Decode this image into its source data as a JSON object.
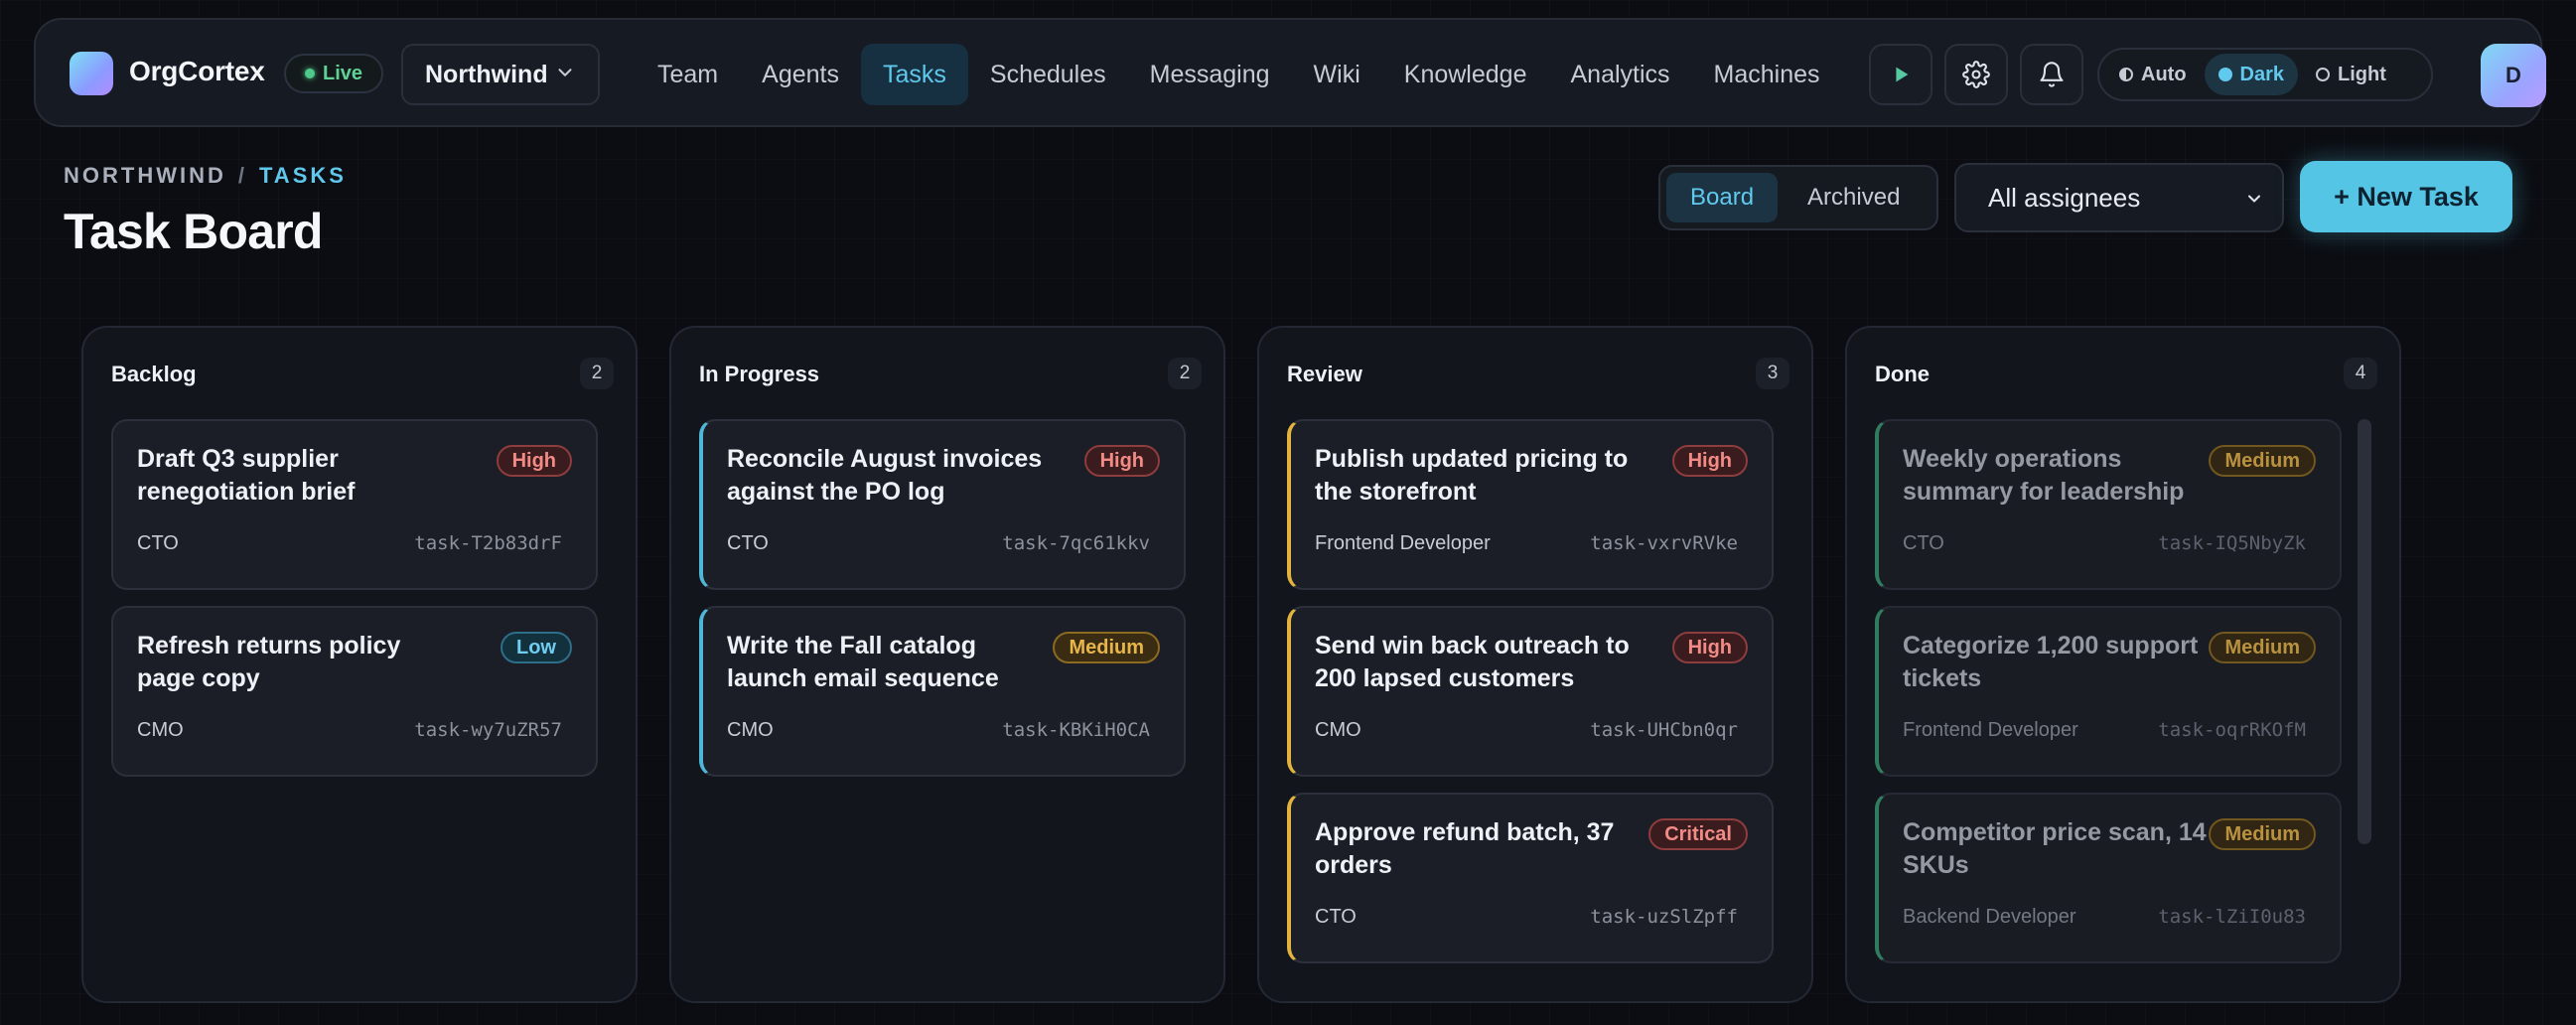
{
  "brand": {
    "name": "OrgCortex",
    "status": "Live"
  },
  "workspace": {
    "selected": "Northwind"
  },
  "nav": [
    {
      "label": "Team"
    },
    {
      "label": "Agents"
    },
    {
      "label": "Tasks",
      "active": true
    },
    {
      "label": "Schedules"
    },
    {
      "label": "Messaging"
    },
    {
      "label": "Wiki"
    },
    {
      "label": "Knowledge"
    },
    {
      "label": "Analytics"
    },
    {
      "label": "Machines"
    }
  ],
  "toolbar_icons": [
    "play-icon",
    "gear-icon",
    "bell-icon"
  ],
  "theme": {
    "options": [
      "Auto",
      "Dark",
      "Light"
    ],
    "selected": "Dark"
  },
  "user": {
    "initial": "D"
  },
  "breadcrumb": {
    "root": "NORTHWIND",
    "separator": "/",
    "current": "TASKS"
  },
  "page": {
    "title": "Task Board"
  },
  "view_toggle": {
    "options": [
      "Board",
      "Archived"
    ],
    "selected": "Board"
  },
  "assignee_filter": {
    "value": "All assignees"
  },
  "new_task_label": "+ New Task",
  "colors": {
    "accent": "#55c5e6",
    "in_progress": "#4fb6d8",
    "review": "#e3b33f",
    "done": "#3a9a72",
    "live": "#4ec98a"
  },
  "columns": [
    {
      "title": "Backlog",
      "count": "2",
      "cards": [
        {
          "title": "Draft Q3 supplier renegotiation brief",
          "priority": "High",
          "role": "CTO",
          "id": "task-T2b83drF"
        },
        {
          "title": "Refresh returns policy page copy",
          "priority": "Low",
          "role": "CMO",
          "id": "task-wy7uZR57"
        }
      ]
    },
    {
      "title": "In Progress",
      "count": "2",
      "cards": [
        {
          "title": "Reconcile August invoices against the PO log",
          "priority": "High",
          "role": "CTO",
          "id": "task-7qc61kkv"
        },
        {
          "title": "Write the Fall catalog launch email sequence",
          "priority": "Medium",
          "role": "CMO",
          "id": "task-KBKiH0CA"
        }
      ]
    },
    {
      "title": "Review",
      "count": "3",
      "cards": [
        {
          "title": "Publish updated pricing to the storefront",
          "priority": "High",
          "role": "Frontend Developer",
          "id": "task-vxrvRVke"
        },
        {
          "title": "Send win back outreach to 200 lapsed customers",
          "priority": "High",
          "role": "CMO",
          "id": "task-UHCbn0qr"
        },
        {
          "title": "Approve refund batch, 37 orders",
          "priority": "Critical",
          "role": "CTO",
          "id": "task-uzSlZpff"
        }
      ]
    },
    {
      "title": "Done",
      "count": "4",
      "cards": [
        {
          "title": "Weekly operations summary for leadership",
          "priority": "Medium",
          "role": "CTO",
          "id": "task-IQ5NbyZk"
        },
        {
          "title": "Categorize 1,200 support tickets",
          "priority": "Medium",
          "role": "Frontend Developer",
          "id": "task-oqrRKOfM"
        },
        {
          "title": "Competitor price scan, 14 SKUs",
          "priority": "Medium",
          "role": "Backend Developer",
          "id": "task-lZiI0u83"
        }
      ]
    }
  ]
}
